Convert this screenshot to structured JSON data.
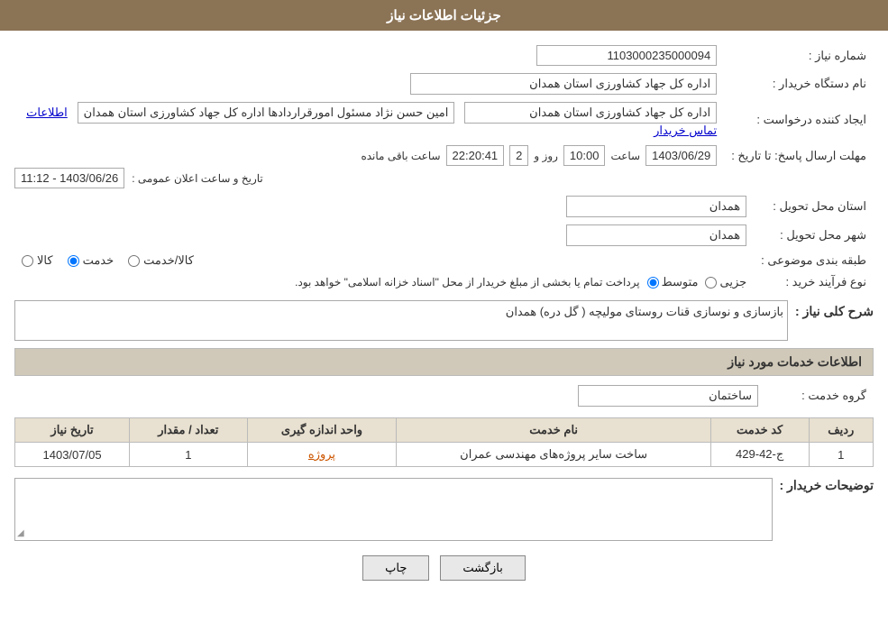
{
  "header": {
    "title": "جزئیات اطلاعات نیاز"
  },
  "fields": {
    "need_number_label": "شماره نیاز :",
    "need_number_value": "1103000235000094",
    "buyer_org_label": "نام دستگاه خریدار :",
    "buyer_org_value": "اداره کل جهاد کشاورزی استان همدان",
    "creator_label": "ایجاد کننده درخواست :",
    "creator_value": "اداره کل جهاد کشاورزی استان همدان",
    "responsible_label": "امین حسن نژاد مسئول امورقراردادها اداره کل جهاد کشاورزی استان همدان",
    "contact_link": "اطلاعات تماس خریدار",
    "send_date_label": "مهلت ارسال پاسخ: تا تاریخ :",
    "send_date_value": "1403/06/29",
    "send_time_label": "ساعت",
    "send_time_value": "10:00",
    "send_day_label": "روز و",
    "send_day_value": "2",
    "remaining_label": "ساعت باقی مانده",
    "remaining_value": "22:20:41",
    "announce_label": "تاریخ و ساعت اعلان عمومی :",
    "announce_value": "1403/06/26 - 11:12",
    "province_label": "استان محل تحویل :",
    "province_value": "همدان",
    "city_label": "شهر محل تحویل :",
    "city_value": "همدان",
    "category_label": "طبقه بندی موضوعی :",
    "category_goods": "کالا",
    "category_service": "خدمت",
    "category_goods_service": "کالا/خدمت",
    "process_label": "نوع فرآیند خرید :",
    "process_retail": "جزیی",
    "process_medium": "متوسط",
    "process_note": "پرداخت تمام یا بخشی از مبلغ خریدار از محل \"اسناد خزانه اسلامی\" خواهد بود.",
    "description_section": "شرح کلی نیاز :",
    "description_value": "بازسازی و نوسازی قنات روستای مولیچه ( گل دره) همدان",
    "services_section": "اطلاعات خدمات مورد نیاز",
    "service_group_label": "گروه خدمت :",
    "service_group_value": "ساختمان",
    "services_table": {
      "columns": [
        "ردیف",
        "کد خدمت",
        "نام خدمت",
        "واحد اندازه گیری",
        "تعداد / مقدار",
        "تاریخ نیاز"
      ],
      "rows": [
        {
          "row": "1",
          "code": "ج-42-429",
          "name": "ساخت سایر پروژه‌های مهندسی عمران",
          "unit": "پروژه",
          "quantity": "1",
          "date": "1403/07/05"
        }
      ]
    },
    "buyer_notes_label": "توضیحات خریدار :",
    "buyer_notes_value": ""
  },
  "buttons": {
    "print_label": "چاپ",
    "back_label": "بازگشت"
  }
}
